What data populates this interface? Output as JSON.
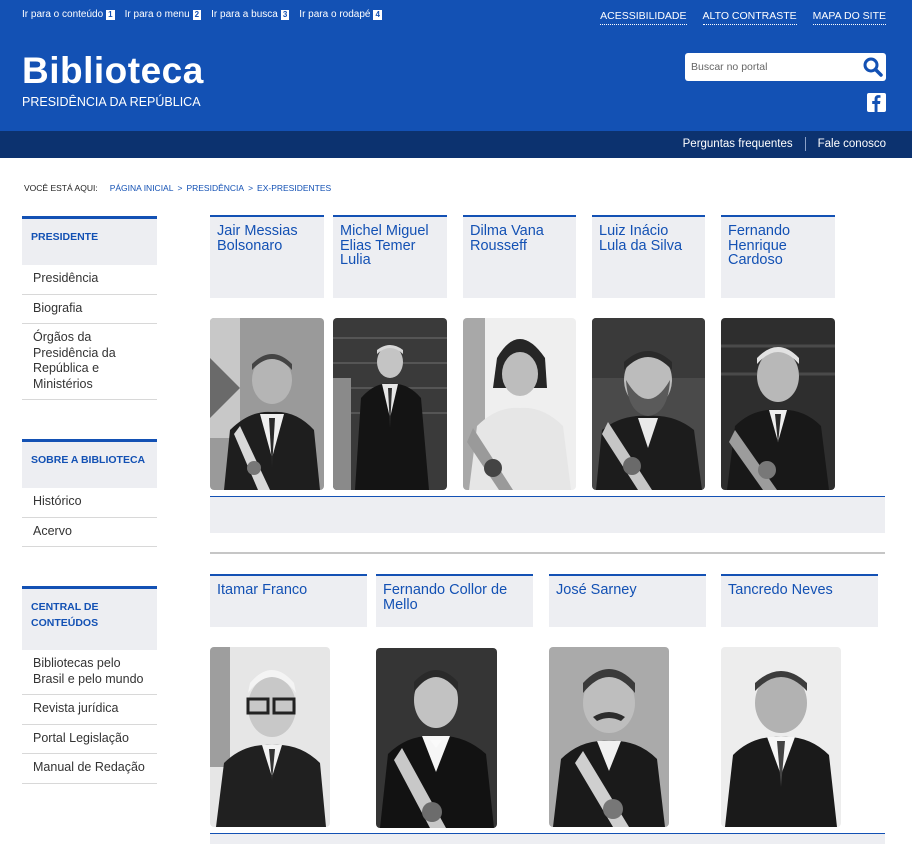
{
  "accessibility_bar": {
    "skip_links": [
      {
        "label": "Ir para o conteúdo",
        "num": "1"
      },
      {
        "label": "Ir para o menu",
        "num": "2"
      },
      {
        "label": "Ir para a busca",
        "num": "3"
      },
      {
        "label": "Ir para o rodapé",
        "num": "4"
      }
    ],
    "top_links": [
      "ACESSIBILIDADE",
      "ALTO CONTRASTE",
      "MAPA DO SITE"
    ]
  },
  "header": {
    "title": "Biblioteca",
    "subtitle": "PRESIDÊNCIA DA REPÚBLICA",
    "search_placeholder": "Buscar no portal",
    "search_icon": "search-icon",
    "social_icon": "facebook-icon"
  },
  "service_bar": {
    "links": [
      "Perguntas frequentes",
      "Fale conosco"
    ]
  },
  "breadcrumb": {
    "label": "VOCÊ ESTÁ AQUI:",
    "items": [
      "PÁGINA INICIAL",
      "PRESIDÊNCIA",
      "EX-PRESIDENTES"
    ]
  },
  "sidebar": {
    "sections": [
      {
        "title": "PRESIDENTE",
        "items": [
          "Presidência",
          "Biografia",
          "Órgãos da Presidência da República e Ministérios"
        ]
      },
      {
        "title": "SOBRE A BIBLIOTECA",
        "items": [
          "Histórico",
          "Acervo"
        ]
      },
      {
        "title": "CENTRAL DE CONTEÚDOS",
        "items": [
          "Bibliotecas pelo Brasil e pelo mundo",
          "Revista jurídica",
          "Portal Legislação",
          "Manual de Redação"
        ]
      }
    ]
  },
  "presidents": {
    "row1": [
      {
        "name": "Jair Messias Bolsonaro"
      },
      {
        "name": "Michel Miguel Elias Temer Lulia"
      },
      {
        "name": "Dilma Vana Rousseff"
      },
      {
        "name": "Luiz Inácio Lula da Silva"
      },
      {
        "name": "Fernando Henrique Cardoso"
      }
    ],
    "row2": [
      {
        "name": "Itamar Franco"
      },
      {
        "name": "Fernando Collor de Mello"
      },
      {
        "name": "José Sarney"
      },
      {
        "name": "Tancredo Neves"
      }
    ]
  },
  "colors": {
    "primary": "#1351b4",
    "dark_blue": "#0c326f",
    "light_gray": "#edeef2"
  }
}
